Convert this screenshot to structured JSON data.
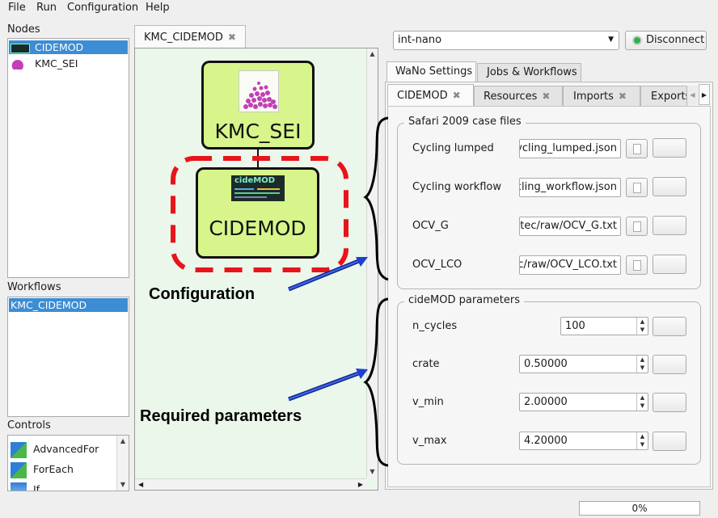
{
  "menu": {
    "file": "File",
    "run": "Run",
    "configuration": "Configuration",
    "help": "Help"
  },
  "left": {
    "nodes_label": "Nodes",
    "nodes": [
      {
        "label": "CIDEMOD",
        "selected": true,
        "icon": "cidemod-thumbnail-icon"
      },
      {
        "label": "KMC_SEI",
        "selected": false,
        "icon": "kmc-sei-icon"
      }
    ],
    "workflows_label": "Workflows",
    "workflows": [
      {
        "label": "KMC_CIDEMOD",
        "selected": true
      }
    ],
    "controls_label": "Controls",
    "controls": [
      {
        "label": "AdvancedFor",
        "icon": "advanced-for-icon"
      },
      {
        "label": "ForEach",
        "icon": "for-each-icon"
      },
      {
        "label": "If",
        "icon": "if-icon"
      }
    ]
  },
  "editor": {
    "tab_label": "KMC_CIDEMOD",
    "nodes": {
      "kmc_sei": {
        "title": "KMC_SEI"
      },
      "cidemod": {
        "title": "CIDEMOD",
        "logo_text": "cideMOD"
      }
    }
  },
  "annotations": {
    "configuration": "Configuration",
    "required": "Required parameters"
  },
  "right": {
    "server_combo": "int-nano",
    "disconnect_label": "Disconnect",
    "outer_tabs": [
      "WaNo Settings",
      "Jobs & Workflows"
    ],
    "inner_tabs": [
      "CIDEMOD",
      "Resources",
      "Imports",
      "Exports"
    ],
    "safari_group": {
      "title": "Safari 2009 case files",
      "fields": [
        {
          "label": "Cycling lumped",
          "value": "cycling_lumped.json"
        },
        {
          "label": "Cycling workflow",
          "value": "cycling_workflow.json"
        },
        {
          "label": "OCV_G",
          "value": "letec/raw/OCV_G.txt"
        },
        {
          "label": "OCV_LCO",
          "value": "ec/raw/OCV_LCO.txt"
        }
      ]
    },
    "params_group": {
      "title": "cideMOD parameters",
      "fields": [
        {
          "label": "n_cycles",
          "value": "100"
        },
        {
          "label": "crate",
          "value": "0.50000"
        },
        {
          "label": "v_min",
          "value": "2.00000"
        },
        {
          "label": "v_max",
          "value": "4.20000"
        }
      ]
    }
  },
  "status": {
    "progress": "0%",
    "progress_fraction": 0
  },
  "colors": {
    "node_fill": "#d7f58a",
    "selection": "#3c8dd3",
    "dash_red": "#e8141b",
    "arrow_blue": "#1f3fd0",
    "status_green": "#2ab34a"
  }
}
